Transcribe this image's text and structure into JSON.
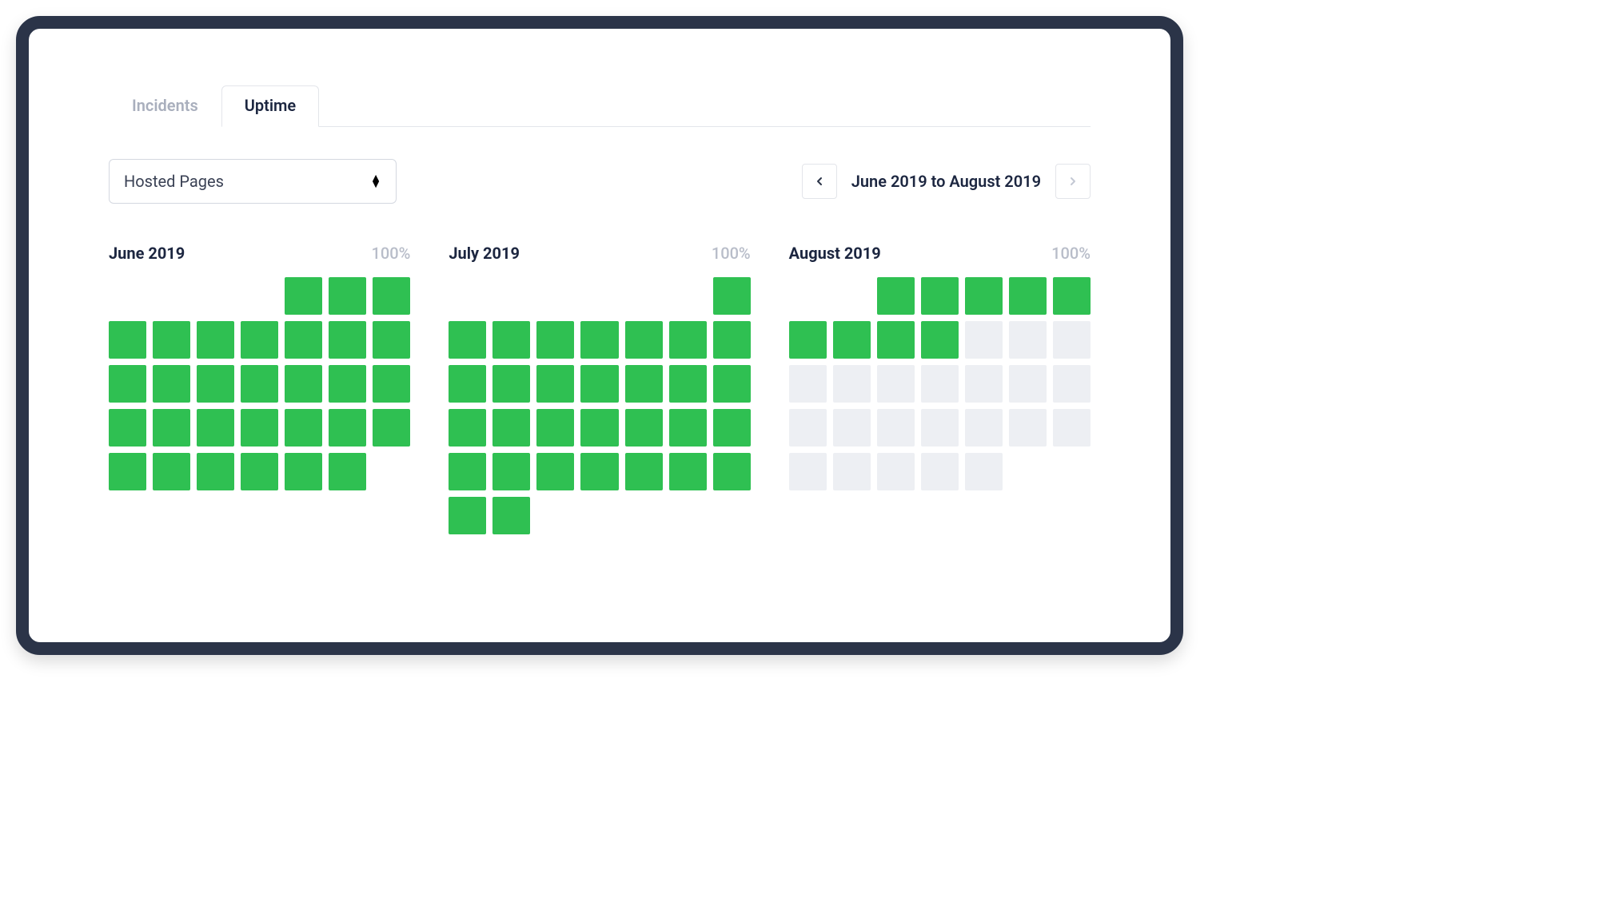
{
  "tabs": {
    "incidents": "Incidents",
    "uptime": "Uptime"
  },
  "controls": {
    "selected_service": "Hosted Pages",
    "date_range": "June 2019 to August 2019"
  },
  "months": [
    {
      "name": "June 2019",
      "uptime_pct": "100%",
      "lead_blanks": 4,
      "days": [
        "green",
        "green",
        "green",
        "green",
        "green",
        "green",
        "green",
        "green",
        "green",
        "green",
        "green",
        "green",
        "green",
        "green",
        "green",
        "green",
        "green",
        "green",
        "green",
        "green",
        "green",
        "green",
        "green",
        "green",
        "green",
        "green",
        "green",
        "green",
        "green",
        "green"
      ]
    },
    {
      "name": "July 2019",
      "uptime_pct": "100%",
      "lead_blanks": 6,
      "days": [
        "green",
        "green",
        "green",
        "green",
        "green",
        "green",
        "green",
        "green",
        "green",
        "green",
        "green",
        "green",
        "green",
        "green",
        "green",
        "green",
        "green",
        "green",
        "green",
        "green",
        "green",
        "green",
        "green",
        "green",
        "green",
        "green",
        "green",
        "green",
        "green",
        "green",
        "green"
      ]
    },
    {
      "name": "August 2019",
      "uptime_pct": "100%",
      "lead_blanks": 2,
      "days": [
        "green",
        "green",
        "green",
        "green",
        "green",
        "green",
        "green",
        "green",
        "green",
        "grey",
        "grey",
        "grey",
        "grey",
        "grey",
        "grey",
        "grey",
        "grey",
        "grey",
        "grey",
        "grey",
        "grey",
        "grey",
        "grey",
        "grey",
        "grey",
        "grey",
        "grey",
        "grey",
        "grey",
        "grey",
        "grey"
      ]
    }
  ],
  "colors": {
    "green": "#2fc052",
    "grey": "#edeff3",
    "frame": "#2b3448"
  }
}
